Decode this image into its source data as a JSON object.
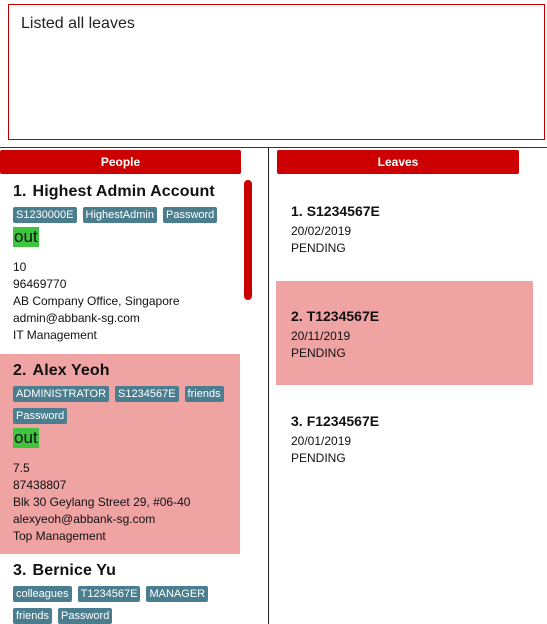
{
  "result": {
    "message": "Listed all leaves"
  },
  "people_panel": {
    "title": "People"
  },
  "leaves_panel": {
    "title": "Leaves"
  },
  "people": [
    {
      "index": "1.",
      "name": "Highest Admin Account",
      "tags": [
        "S1230000E",
        "HighestAdmin",
        "Password"
      ],
      "status": "out",
      "leaves": "10",
      "phone": "96469770",
      "address": "AB Company Office, Singapore",
      "email": "admin@abbank-sg.com",
      "department": "IT Management"
    },
    {
      "index": "2.",
      "name": "Alex Yeoh",
      "tags": [
        "ADMINISTRATOR",
        "S1234567E",
        "friends",
        "Password"
      ],
      "status": "out",
      "leaves": "7.5",
      "phone": "87438807",
      "address": "Blk 30 Geylang Street 29, #06-40",
      "email": "alexyeoh@abbank-sg.com",
      "department": "Top Management"
    },
    {
      "index": "3.",
      "name": "Bernice Yu",
      "tags": [
        "colleagues",
        "T1234567E",
        "MANAGER",
        "friends",
        "Password"
      ]
    }
  ],
  "leaves": [
    {
      "index": "1.",
      "nric": "S1234567E",
      "date": "20/02/2019",
      "status": "PENDING"
    },
    {
      "index": "2.",
      "nric": "T1234567E",
      "date": "20/11/2019",
      "status": "PENDING"
    },
    {
      "index": "3.",
      "nric": "F1234567E",
      "date": "20/01/2019",
      "status": "PENDING"
    }
  ],
  "colors": {
    "accent": "#cc0000",
    "selected": "#efa3a3",
    "tag": "#4a7e8f",
    "status_out": "#3ec43e"
  }
}
